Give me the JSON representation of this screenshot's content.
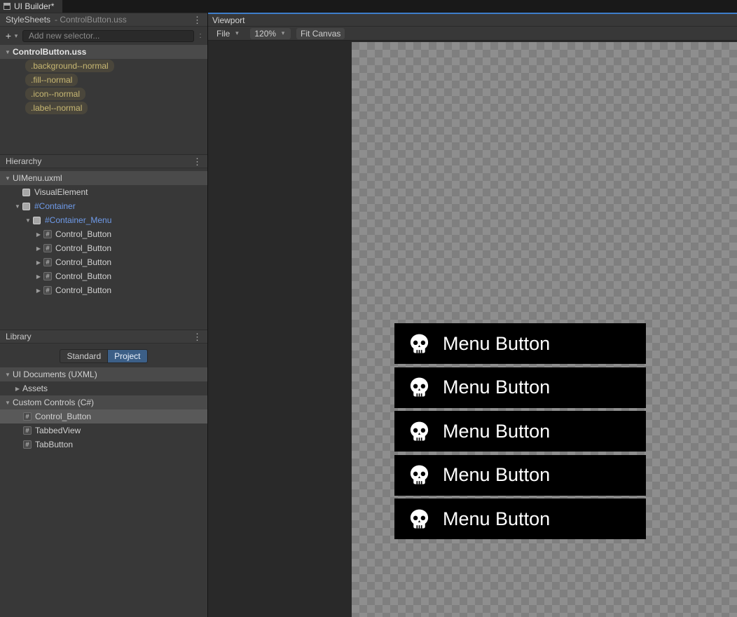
{
  "window": {
    "tab_label": "UI Builder*"
  },
  "stylesheets_panel": {
    "title": "StyleSheets",
    "subtitle": "-  ControlButton.uss",
    "add_selector_placeholder": "Add new selector...",
    "root_label": "ControlButton.uss",
    "selectors": [
      {
        "label": ".background--normal"
      },
      {
        "label": ".fill--normal"
      },
      {
        "label": ".icon--normal"
      },
      {
        "label": ".label--normal"
      }
    ]
  },
  "hierarchy_panel": {
    "title": "Hierarchy",
    "root_label": "UIMenu.uxml",
    "items": [
      {
        "label": "VisualElement"
      },
      {
        "label": "#Container"
      },
      {
        "label": "#Container_Menu"
      },
      {
        "label": "Control_Button"
      },
      {
        "label": "Control_Button"
      },
      {
        "label": "Control_Button"
      },
      {
        "label": "Control_Button"
      },
      {
        "label": "Control_Button"
      }
    ]
  },
  "library_panel": {
    "title": "Library",
    "tabs": [
      {
        "label": "Standard"
      },
      {
        "label": "Project"
      }
    ],
    "sections": [
      {
        "header": "UI Documents (UXML)",
        "items": [
          {
            "label": "Assets"
          }
        ]
      },
      {
        "header": "Custom Controls (C#)",
        "items": [
          {
            "label": "Control_Button"
          },
          {
            "label": "TabbedView"
          },
          {
            "label": "TabButton"
          }
        ]
      }
    ]
  },
  "viewport": {
    "title": "Viewport",
    "toolbar": {
      "file_label": "File",
      "zoom_value": "120%",
      "fit_canvas_label": "Fit Canvas"
    },
    "canvas": {
      "menu_buttons": [
        {
          "label": "Menu Button"
        },
        {
          "label": "Menu Button"
        },
        {
          "label": "Menu Button"
        },
        {
          "label": "Menu Button"
        },
        {
          "label": "Menu Button"
        }
      ]
    }
  },
  "colors": {
    "accent_blue": "#3d7dca",
    "selector_text": "#c8b873",
    "element_name_blue": "#6f9bea",
    "menu_button_bg": "#000000",
    "menu_button_fg": "#ffffff",
    "panel_bg": "#383838"
  }
}
